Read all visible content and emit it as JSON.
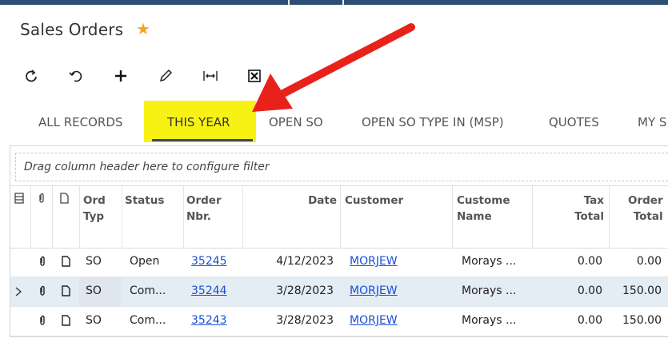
{
  "page": {
    "title": "Sales Orders"
  },
  "icons": {
    "favorite": "star-icon",
    "refresh": "refresh-icon",
    "undo": "undo-icon",
    "add": "plus-icon",
    "edit": "pencil-icon",
    "fit_columns": "fit-columns-icon",
    "export_excel": "excel-icon",
    "annotation": "red-arrow"
  },
  "colors": {
    "star": "#f4a51c",
    "tab_highlight": "#f7f213",
    "annotation_arrow": "#e8221b",
    "link": "#1a4fd6",
    "topbar": "#2e4f74"
  },
  "tabs": [
    {
      "label": "ALL RECORDS",
      "active": false
    },
    {
      "label": "THIS YEAR",
      "active": true
    },
    {
      "label": "OPEN SO",
      "active": false
    },
    {
      "label": "OPEN SO TYPE IN (MSP)",
      "active": false
    },
    {
      "label": "QUOTES",
      "active": false
    },
    {
      "label": "MY S",
      "active": false
    }
  ],
  "grid": {
    "filter_hint": "Drag column header here to configure filter",
    "columns": {
      "order_type": [
        "Ord",
        "Typ"
      ],
      "status": "Status",
      "order_nbr": [
        "Order",
        "Nbr."
      ],
      "date": "Date",
      "customer": "Customer",
      "customer_name": [
        "Custome",
        "Name"
      ],
      "tax_total": [
        "Tax",
        "Total"
      ],
      "order_total": [
        "Order",
        "Total"
      ]
    },
    "rows": [
      {
        "type": "SO",
        "status": "Open",
        "nbr": "35245",
        "date": "4/12/2023",
        "customer": "MORJEW",
        "name": "Morays ...",
        "tax": "0.00",
        "total": "0.00",
        "selected": false
      },
      {
        "type": "SO",
        "status": "Com...",
        "nbr": "35244",
        "date": "3/28/2023",
        "customer": "MORJEW",
        "name": "Morays ...",
        "tax": "0.00",
        "total": "150.00",
        "selected": true
      },
      {
        "type": "SO",
        "status": "Com...",
        "nbr": "35243",
        "date": "3/28/2023",
        "customer": "MORJEW",
        "name": "Morays ...",
        "tax": "0.00",
        "total": "150.00",
        "selected": false
      }
    ]
  }
}
